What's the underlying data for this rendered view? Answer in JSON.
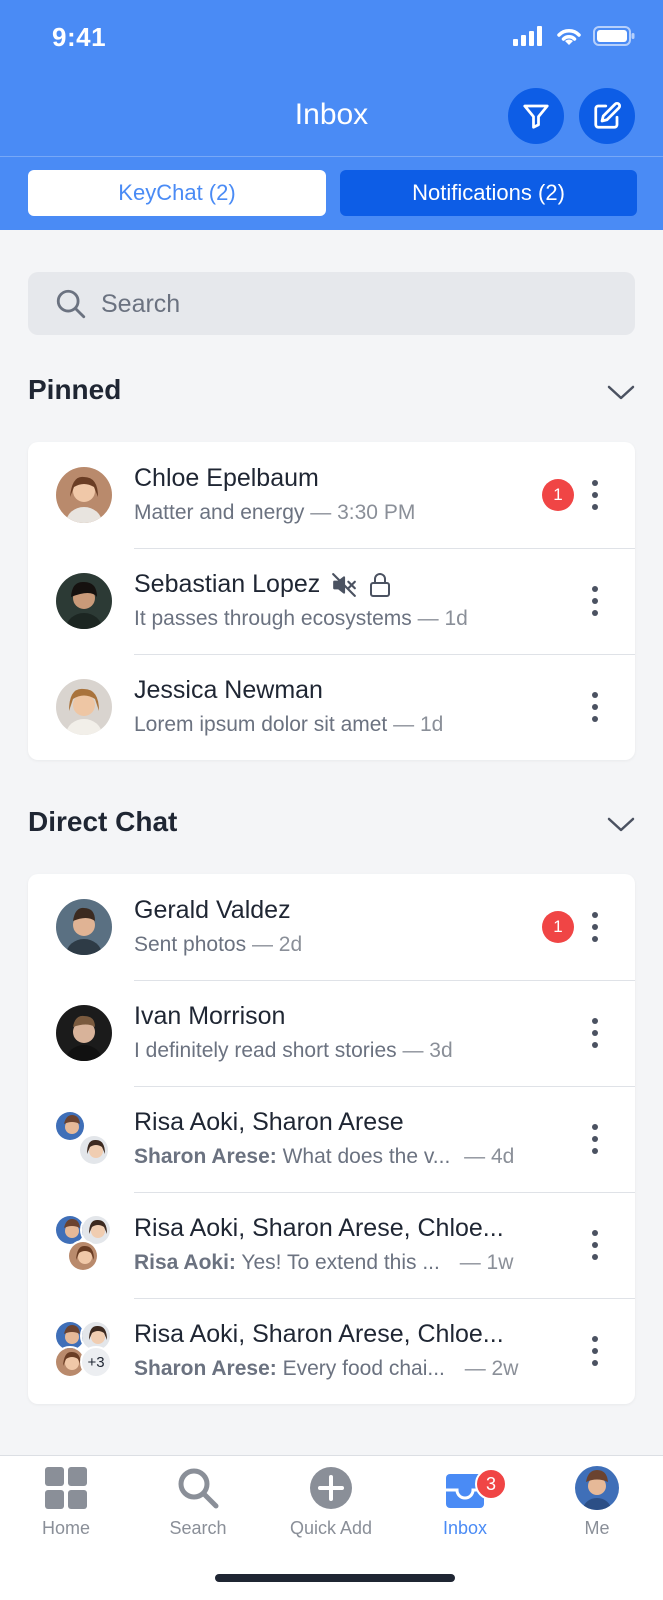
{
  "status_bar": {
    "time": "9:41"
  },
  "header": {
    "title": "Inbox",
    "filter_icon": "filter-icon",
    "compose_icon": "compose-icon",
    "tabs": [
      {
        "label": "KeyChat (2)",
        "active": true
      },
      {
        "label": "Notifications (2)",
        "active": false
      }
    ]
  },
  "search": {
    "placeholder": "Search"
  },
  "pinned": {
    "title": "Pinned",
    "items": [
      {
        "name": "Chloe Epelbaum",
        "message": "Matter and energy",
        "time": "— 3:30 PM",
        "unread": "1"
      },
      {
        "name": "Sebastian Lopez",
        "message": "It passes through ecosystems",
        "time": "— 1d",
        "muted": true,
        "locked": true
      },
      {
        "name": "Jessica Newman",
        "message": "Lorem ipsum dolor sit amet",
        "time": "— 1d"
      }
    ]
  },
  "direct": {
    "title": "Direct Chat",
    "items": [
      {
        "name": "Gerald Valdez",
        "message": "Sent photos",
        "time": "— 2d",
        "unread": "1"
      },
      {
        "name": "Ivan Morrison",
        "message": " I definitely read short stories",
        "time": "— 3d"
      },
      {
        "name": "Risa Aoki, Sharon Arese",
        "sender": "Sharon Arese:",
        "message": "What does the v...",
        "time": "— 4d"
      },
      {
        "name": "Risa Aoki, Sharon Arese, Chloe...",
        "sender": "Risa Aoki:",
        "message": "Yes! To extend this ...",
        "time": "— 1w"
      },
      {
        "name": "Risa Aoki, Sharon Arese, Chloe...",
        "sender": "Sharon Arese:",
        "message": "Every food chai...",
        "time": "— 2w",
        "extra_count": "+3"
      }
    ]
  },
  "tabbar": {
    "items": [
      {
        "label": "Home",
        "icon": "grid-icon"
      },
      {
        "label": "Search",
        "icon": "search-icon"
      },
      {
        "label": "Quick Add",
        "icon": "plus-circle-icon"
      },
      {
        "label": "Inbox",
        "icon": "inbox-icon",
        "badge": "3",
        "active": true
      },
      {
        "label": "Me",
        "icon": "avatar"
      }
    ]
  },
  "colors": {
    "primary": "#4a8bf5",
    "primary_dark": "#0d5de6",
    "badge": "#f04545"
  }
}
